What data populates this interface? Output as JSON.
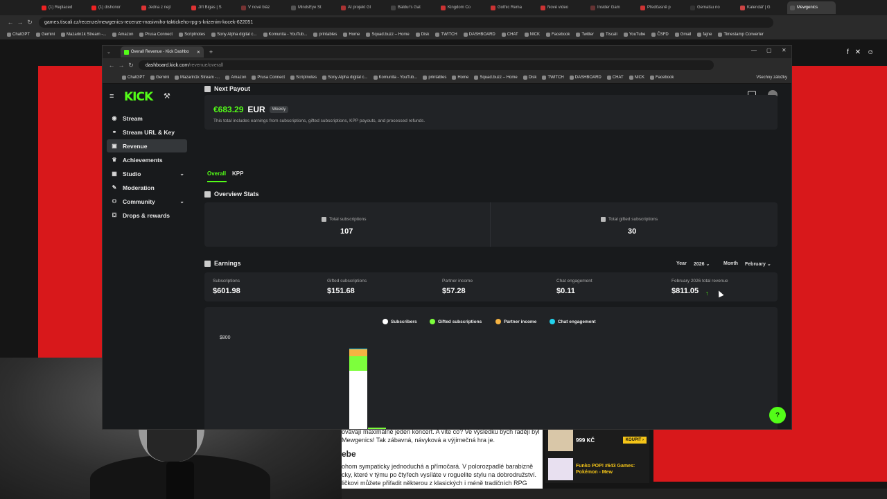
{
  "outer_browser": {
    "tabs": [
      "(1) Replaced",
      "(1) dishonor",
      "Jedna z nejl",
      "Jiří Bigas | S",
      "V nové bláz",
      "MindsEye St",
      "AI projekt Gl",
      "Baldur's Gat",
      "Kingdom Co",
      "Gothic Rema",
      "Nové video",
      "Insider Gam",
      "Předčasně p",
      "Gematsu no",
      "Kalendář | G",
      "Mewgenics"
    ],
    "url": "games.tiscali.cz/recenze/mewgenics-recenze-masivniho-taktickeho-rpg-s-krizenim-kocek-622051",
    "bookmarks": [
      "ChatGPT",
      "Gemini",
      "Mazarin1k Stream -...",
      "Amazon",
      "Prusa Connect",
      "Scriptnotes",
      "Sony Alpha digital c...",
      "Komunita - YouTub...",
      "printables",
      "Home",
      "Squad.buzz – Home",
      "Disk",
      "TWITCH",
      "DASHBOARD",
      "CHAT",
      "NICK",
      "Facebook",
      "Twitter",
      "Tiscali",
      "YouTube",
      "ČSFD",
      "Gmail",
      "fajne",
      "Timestamp Converter"
    ]
  },
  "article": {
    "lines_top": [
      "ovávají maximálně jeden koncert. A víte co? Ve výsledku bych raději byl",
      "Mewgenics! Tak zábavná, návyková a výjimečná hra je."
    ],
    "heading": "ebe",
    "lines_bottom": [
      "ohom sympaticky jednoduchá a přímočará. V polorozpadlé barabizně",
      "cky, které v týmu po čtyřech vysíláte v roguelite stylu na dobrodružství.",
      "ličkovi můžete přiřadit některou z klasických i méně tradičních RPG"
    ]
  },
  "ad": {
    "price": "999 KČ",
    "buy_label": "KOUPIT ›",
    "product_title": "Funko POP! #643 Games: Pokémon - Mew"
  },
  "inner_browser": {
    "tab_title": "Overall Revenue - Kick Dashbo",
    "url_host": "dashboard.kick.com",
    "url_path": "/revenue/overall",
    "bookmarks": [
      "ChatGPT",
      "Gemini",
      "Mazarin1k Stream -...",
      "Amazon",
      "Prusa Connect",
      "Scriptnotes",
      "Sony Alpha digital c...",
      "Komunita - YouTub...",
      "printables",
      "Home",
      "Squad.buzz – Home",
      "Disk",
      "TWITCH",
      "DASHBOARD",
      "CHAT",
      "NICK",
      "Facebook"
    ],
    "other_bookmarks": "Všechny záložky"
  },
  "kick": {
    "logo": "KICK",
    "sidebar": [
      {
        "label": "Stream",
        "icon": "broadcast-icon",
        "glyph": "◉",
        "active": false,
        "expandable": false
      },
      {
        "label": "Stream URL & Key",
        "icon": "link-icon",
        "glyph": "⚭",
        "active": false,
        "expandable": false
      },
      {
        "label": "Revenue",
        "icon": "wallet-icon",
        "glyph": "▣",
        "active": true,
        "expandable": false
      },
      {
        "label": "Achievements",
        "icon": "trophy-icon",
        "glyph": "♛",
        "active": false,
        "expandable": false
      },
      {
        "label": "Studio",
        "icon": "studio-icon",
        "glyph": "▦",
        "active": false,
        "expandable": true
      },
      {
        "label": "Moderation",
        "icon": "wrench-icon",
        "glyph": "✎",
        "active": false,
        "expandable": false
      },
      {
        "label": "Community",
        "icon": "community-icon",
        "glyph": "⚇",
        "active": false,
        "expandable": true
      },
      {
        "label": "Drops & rewards",
        "icon": "gift-icon",
        "glyph": "⛋",
        "active": false,
        "expandable": false
      }
    ],
    "next_payout": {
      "title": "Next Payout",
      "amount": "€683.29",
      "currency": "EUR",
      "badge": "Weekly",
      "description": "This total includes earnings from subscriptions, gifted subscriptions, KPP payouts, and processed refunds."
    },
    "tabs": [
      "Overall",
      "KPP"
    ],
    "active_tab": "Overall",
    "overview": {
      "title": "Overview Stats",
      "total_subscriptions_label": "Total subscriptions",
      "total_subscriptions": "107",
      "total_gifted_label": "Total gifted subscriptions",
      "total_gifted": "30"
    },
    "earnings": {
      "title": "Earnings",
      "year_label": "Year",
      "year_value": "2026",
      "month_label": "Month",
      "month_value": "February",
      "items": [
        {
          "label": "Subscriptions",
          "value": "$601.98"
        },
        {
          "label": "Gifted subscriptions",
          "value": "$151.68"
        },
        {
          "label": "Partner income",
          "value": "$57.28"
        },
        {
          "label": "Chat engagement",
          "value": "$0.11"
        },
        {
          "label": "February 2026 total revenue",
          "value": "$811.05"
        }
      ]
    }
  },
  "chart_data": {
    "type": "bar",
    "stacked": true,
    "ytick_top": "$800",
    "ylim": [
      0,
      800
    ],
    "legend": [
      "Subscribers",
      "Gifted subscriptions",
      "Partner income",
      "Chat engagement"
    ],
    "series": [
      {
        "name": "Subscribers",
        "color": "#ffffff",
        "values": [
          490,
          14
        ]
      },
      {
        "name": "Gifted subscriptions",
        "color": "#7dff3c",
        "values": [
          120,
          10
        ]
      },
      {
        "name": "Partner income",
        "color": "#f5b342",
        "values": [
          57,
          0
        ]
      },
      {
        "name": "Chat engagement",
        "color": "#22d3ee",
        "values": [
          0.11,
          0
        ]
      }
    ]
  }
}
